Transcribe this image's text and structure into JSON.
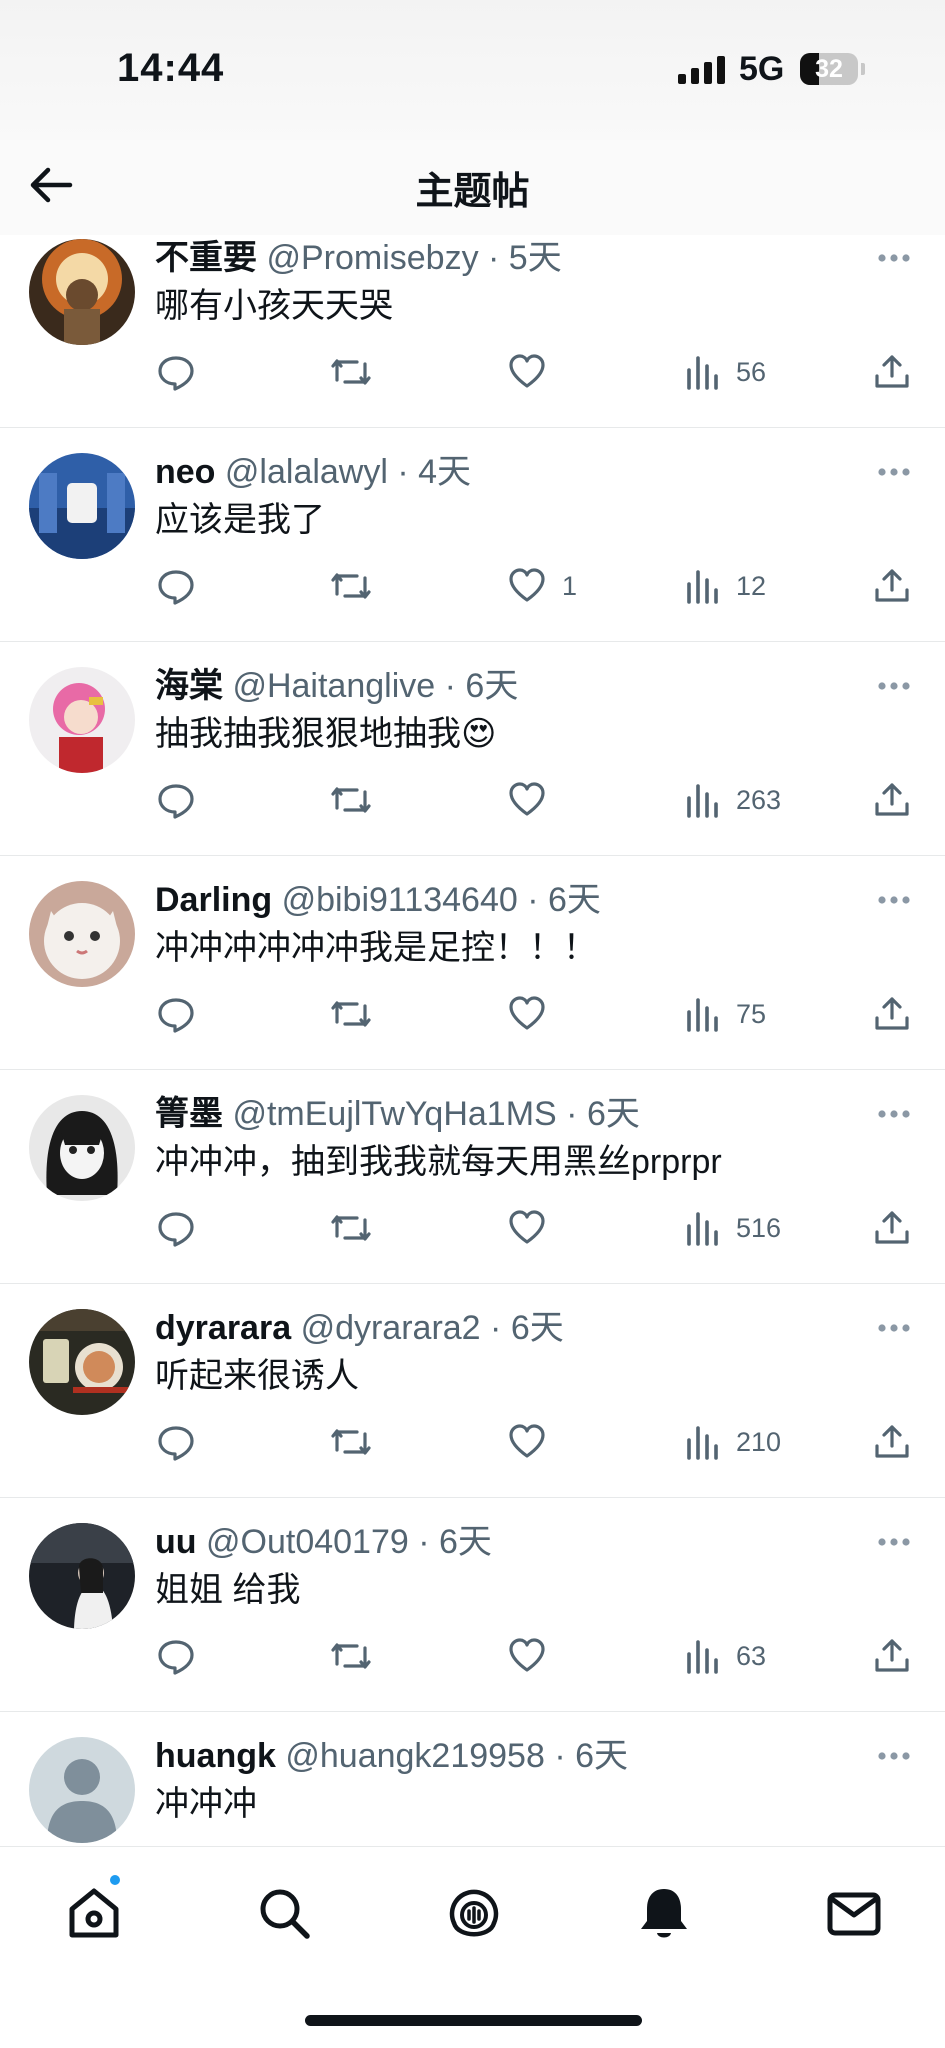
{
  "status_bar": {
    "time": "14:44",
    "network": "5G",
    "battery_percent": "32"
  },
  "nav": {
    "title": "主题帖",
    "back_icon": "arrow-left-icon"
  },
  "posts": [
    {
      "name": "不重要",
      "handle": "@Promisebzy",
      "time": "5天",
      "text": "哪有小孩天天哭",
      "replies": "",
      "reposts": "",
      "likes": "",
      "views": "56"
    },
    {
      "name": "neo",
      "handle": "@lalalawyl",
      "time": "4天",
      "text": "应该是我了",
      "replies": "",
      "reposts": "",
      "likes": "1",
      "views": "12"
    },
    {
      "name": "海棠",
      "handle": "@Haitanglive",
      "time": "6天",
      "text": "抽我抽我狠狠地抽我😍",
      "replies": "",
      "reposts": "",
      "likes": "",
      "views": "263"
    },
    {
      "name": "Darling",
      "handle": "@bibi91134640",
      "time": "6天",
      "text": "冲冲冲冲冲冲我是足控！！！",
      "replies": "",
      "reposts": "",
      "likes": "",
      "views": "75"
    },
    {
      "name": "箐墨",
      "handle": "@tmEujlTwYqHa1MS",
      "time": "6天",
      "text": "冲冲冲，抽到我我就每天用黑丝prprpr",
      "replies": "",
      "reposts": "",
      "likes": "",
      "views": "516"
    },
    {
      "name": "dyrarara",
      "handle": "@dyrarara2",
      "time": "6天",
      "text": "听起来很诱人",
      "replies": "",
      "reposts": "",
      "likes": "",
      "views": "210"
    },
    {
      "name": "uu",
      "handle": "@Out040179",
      "time": "6天",
      "text": "姐姐 给我",
      "replies": "",
      "reposts": "",
      "likes": "",
      "views": "63"
    },
    {
      "name": "huangk",
      "handle": "@huangk219958",
      "time": "6天",
      "text": "冲冲冲",
      "replies": "",
      "reposts": "",
      "likes": "",
      "views": ""
    }
  ],
  "tabs": [
    {
      "icon": "home-icon"
    },
    {
      "icon": "search-icon"
    },
    {
      "icon": "spaces-icon"
    },
    {
      "icon": "bell-icon"
    },
    {
      "icon": "mail-icon"
    }
  ],
  "colors": {
    "accent": "#1d9bf0",
    "text": "#0f1419",
    "muted": "#536471",
    "divider": "#e7e9ea"
  }
}
